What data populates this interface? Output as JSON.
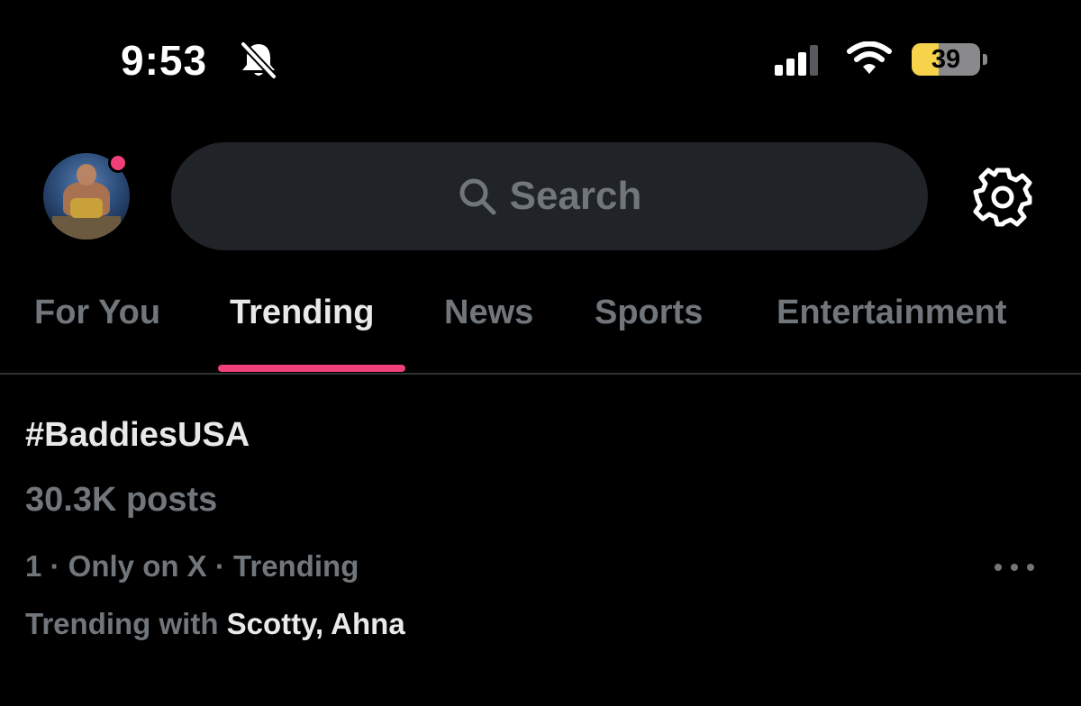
{
  "status_bar": {
    "time": "9:53",
    "battery_level": "39",
    "battery_fraction": 0.39,
    "icons": [
      "bell-slash-icon",
      "cellular-signal-icon",
      "wifi-icon",
      "battery-icon"
    ]
  },
  "header": {
    "search_placeholder": "Search",
    "avatar_icon": "profile-avatar",
    "settings_icon": "gear-icon"
  },
  "tabs": [
    {
      "label": "For You",
      "active": false
    },
    {
      "label": "Trending",
      "active": true
    },
    {
      "label": "News",
      "active": false
    },
    {
      "label": "Sports",
      "active": false
    },
    {
      "label": "Entertainment",
      "active": false
    }
  ],
  "trend": {
    "hashtag": "#BaddiesUSA",
    "posts": "30.3K posts",
    "meta": "1 · Only on X · Trending",
    "with_prefix": "Trending with",
    "with_names": "Scotty, Ahna",
    "more_icon": "more-horizontal-icon"
  },
  "colors": {
    "background": "#000000",
    "accent": "#f0407a",
    "search_bg": "#202327",
    "muted_text": "#71767b",
    "battery": "#f6d34a"
  }
}
